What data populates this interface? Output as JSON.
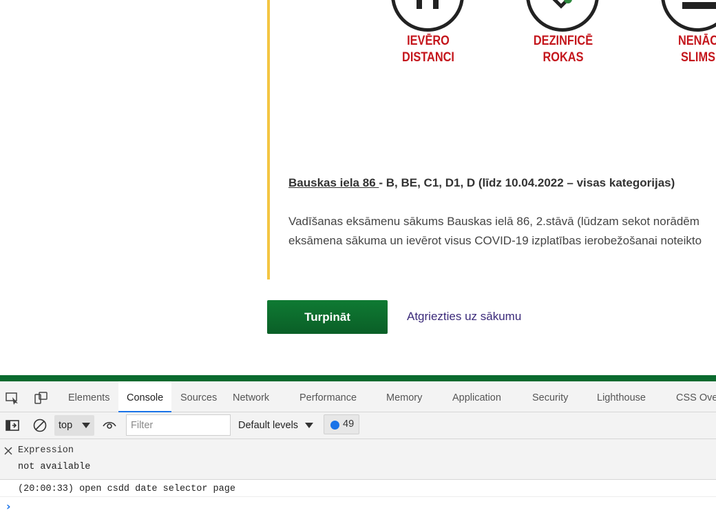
{
  "webpage": {
    "icons": [
      {
        "line1": "IEVĒRO",
        "line2": "DISTANCI",
        "icon": "people-distance-icon"
      },
      {
        "line1": "DEZINFICĒ",
        "line2": "ROKAS",
        "icon": "hand-sanitize-icon"
      },
      {
        "line1": "NENĀC",
        "line2": "SLIMS",
        "icon": "sick-person-icon"
      }
    ],
    "location": {
      "link_text": "Bauskas iela 86 ",
      "categories": "- B, BE, C1, D1, D (līdz 10.04.2022 – visas kategorijas)"
    },
    "body_lines": [
      "Vadīšanas eksāmenu sākums Bauskas ielā 86, 2.stāvā (lūdzam sekot norādēm",
      "eksāmena sākuma un ievērot visus COVID-19 izplatības ierobežošanai noteikto"
    ],
    "continue_button": "Turpināt",
    "back_link": "Atgriezties uz sākumu",
    "colors": {
      "accent_bar": "#f4c542",
      "button": "#0b6b2c",
      "icon_text": "#c4161c",
      "link": "#3b2a7a"
    }
  },
  "devtools": {
    "tabs": [
      "Elements",
      "Console",
      "Sources",
      "Network",
      "Performance",
      "Memory",
      "Application",
      "Security",
      "Lighthouse",
      "CSS Over"
    ],
    "active_tab": "Console",
    "toolbar": {
      "context": "top",
      "filter_placeholder": "Filter",
      "levels": "Default levels",
      "message_count": "49"
    },
    "expression": {
      "title": "Expression",
      "value": "not available"
    },
    "log": [
      "(20:00:33) open csdd date selector page"
    ],
    "prompt": "›"
  }
}
